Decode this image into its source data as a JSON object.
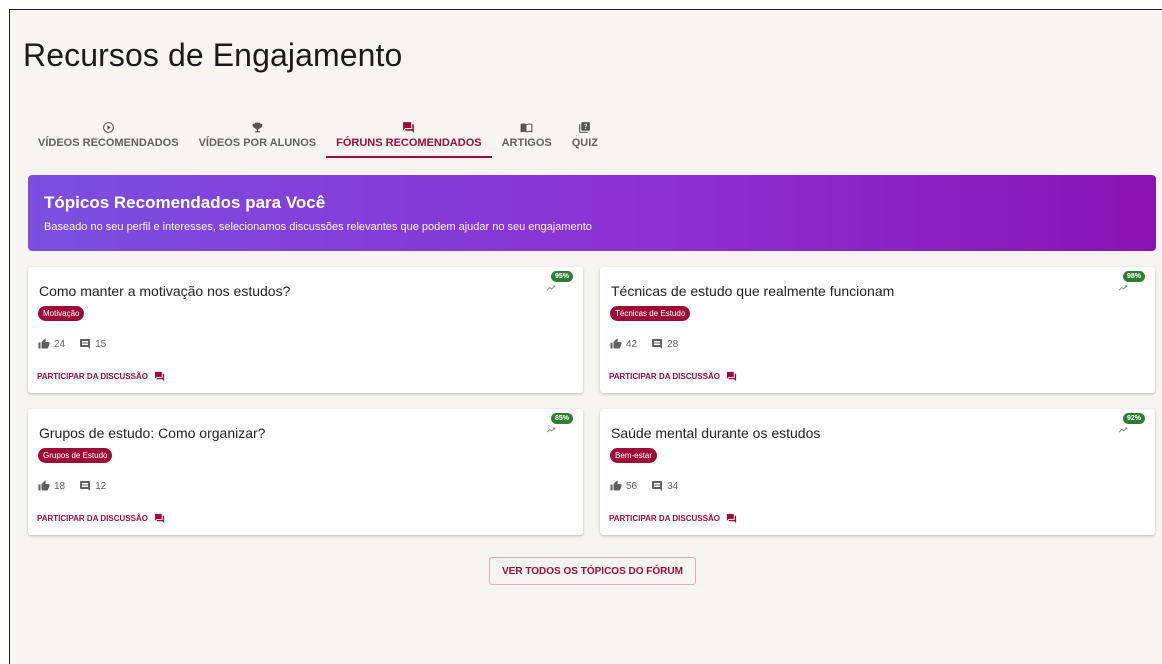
{
  "page": {
    "title": "Recursos de Engajamento"
  },
  "tabs": [
    {
      "label": "VÍDEOS RECOMENDADOS",
      "icon": "play-circle-icon"
    },
    {
      "label": "VÍDEOS POR ALUNOS",
      "icon": "trophy-icon"
    },
    {
      "label": "FÓRUNS RECOMENDADOS",
      "icon": "forum-icon",
      "active": true
    },
    {
      "label": "ARTIGOS",
      "icon": "book-icon"
    },
    {
      "label": "QUIZ",
      "icon": "quiz-icon"
    }
  ],
  "banner": {
    "title": "Tópicos Recomendados para Você",
    "subtitle": "Baseado no seu perfil e interesses, selecionamos discussões relevantes que podem ajudar no seu engajamento"
  },
  "topics": [
    {
      "title": "Como manter a motivação nos estudos?",
      "tag": "Motivação",
      "likes": "24",
      "comments": "15",
      "match": "95%",
      "action": "PARTICIPAR DA DISCUSSÃO"
    },
    {
      "title": "Técnicas de estudo que realmente funcionam",
      "tag": "Técnicas de Estudo",
      "likes": "42",
      "comments": "28",
      "match": "98%",
      "action": "PARTICIPAR DA DISCUSSÃO"
    },
    {
      "title": "Grupos de estudo: Como organizar?",
      "tag": "Grupos de Estudo",
      "likes": "18",
      "comments": "12",
      "match": "85%",
      "action": "PARTICIPAR DA DISCUSSÃO"
    },
    {
      "title": "Saúde mental durante os estudos",
      "tag": "Bem-estar",
      "likes": "56",
      "comments": "34",
      "match": "92%",
      "action": "PARTICIPAR DA DISCUSSÃO"
    }
  ],
  "footer": {
    "view_all_label": "VER TODOS OS TÓPICOS DO FÓRUM"
  },
  "colors": {
    "accent": "#9c0c3b",
    "badge": "#2e7d32",
    "banner_start": "#7b4fe0",
    "banner_end": "#8a13b3"
  }
}
